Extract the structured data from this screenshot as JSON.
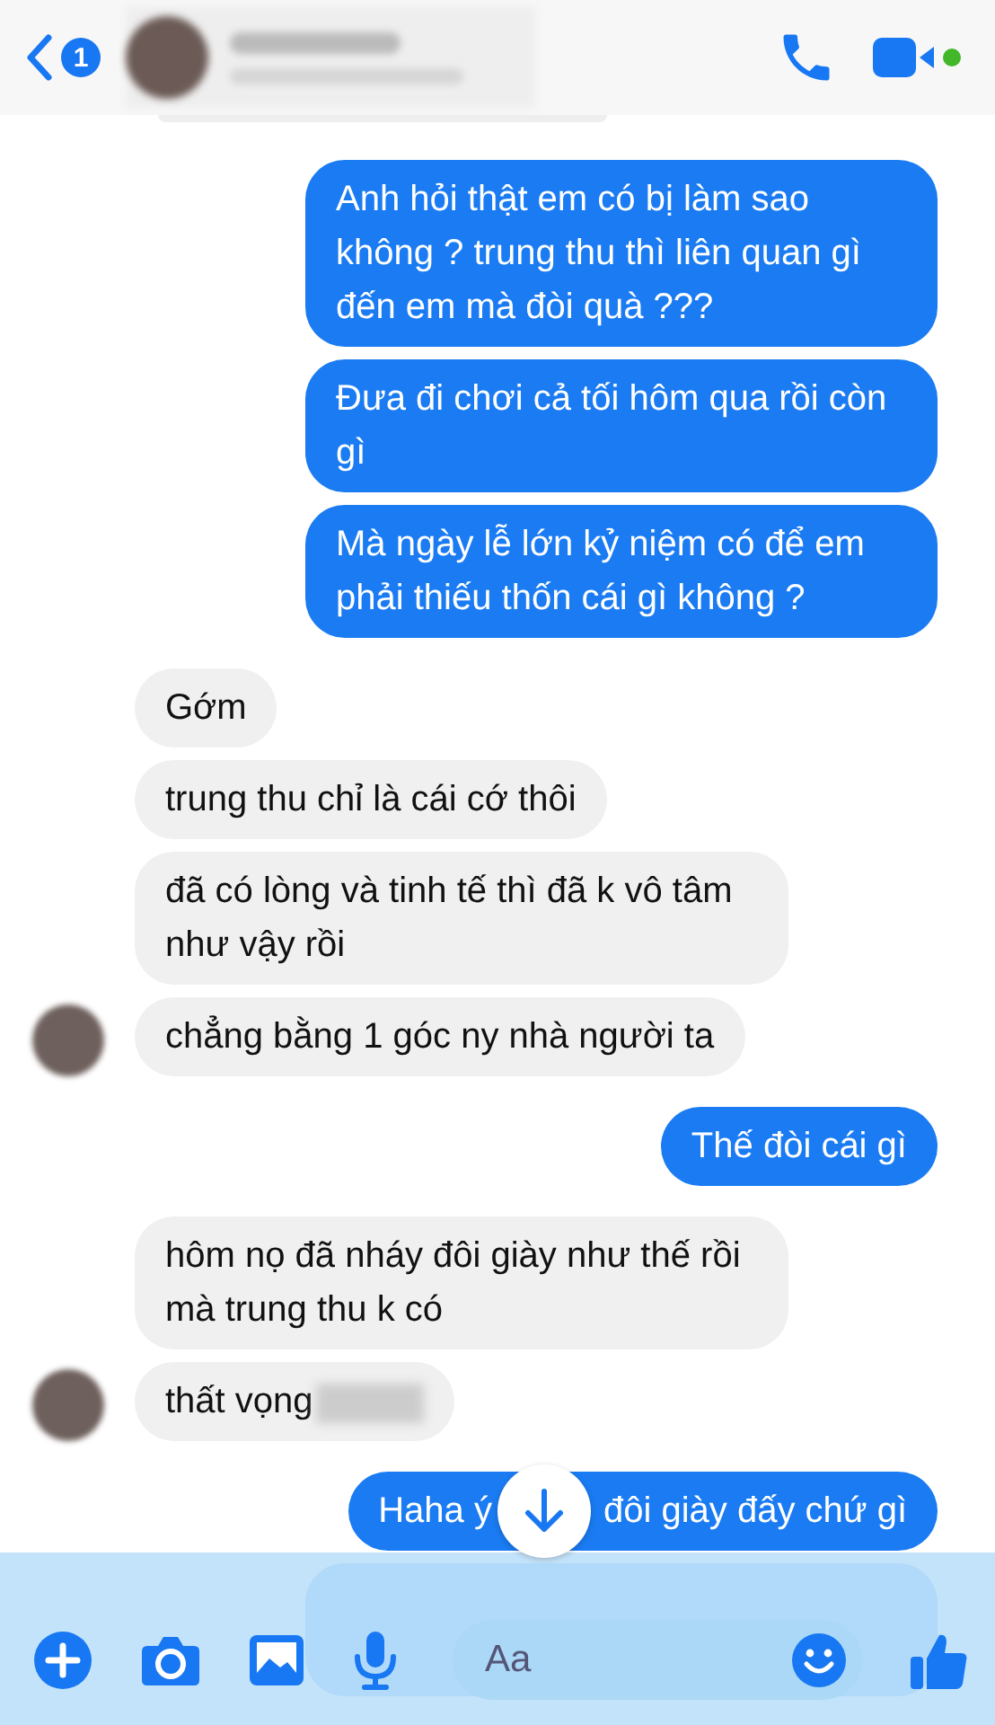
{
  "header": {
    "back_badge": "1"
  },
  "messages": [
    {
      "kind": "sent",
      "text": "Anh hỏi thật em có bị làm sao không ? trung thu thì liên quan gì đến em mà đòi quà ???"
    },
    {
      "kind": "sent",
      "text": "Đưa đi chơi cả tối hôm qua rồi còn gì"
    },
    {
      "kind": "sent",
      "text": "Mà ngày lễ lớn kỷ niệm có để em phải thiếu thốn cái gì không ?"
    },
    {
      "kind": "received",
      "text": "Gớm",
      "avatar": false,
      "blurred_tail": false
    },
    {
      "kind": "received",
      "text": "trung thu chỉ là cái cớ thôi",
      "avatar": false,
      "blurred_tail": false
    },
    {
      "kind": "received",
      "text": "đã có lòng và tinh tế thì đã k vô tâm như vậy rồi",
      "avatar": false,
      "blurred_tail": false
    },
    {
      "kind": "received",
      "text": "chẳng bằng 1 góc ny nhà người ta",
      "avatar": true,
      "blurred_tail": false
    },
    {
      "kind": "sent",
      "text": "Thế đòi cái gì"
    },
    {
      "kind": "received",
      "text": "hôm nọ đã nháy đôi giày như thế rồi mà trung thu k có",
      "avatar": false,
      "blurred_tail": false
    },
    {
      "kind": "received",
      "text": "thất vọng",
      "avatar": true,
      "blurred_tail": true
    },
    {
      "kind": "sent",
      "parts": [
        "Haha ý",
        "đôi giày đấy chứ gì"
      ]
    }
  ],
  "composer": {
    "placeholder": "Aa"
  }
}
